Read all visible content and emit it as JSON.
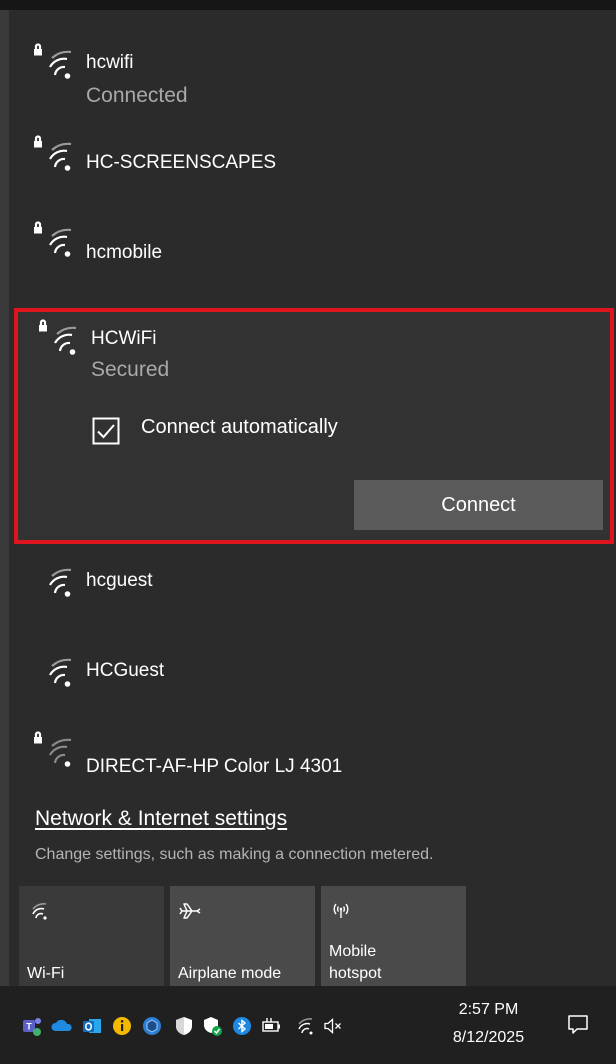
{
  "networks": [
    {
      "name": "hcwifi",
      "status": "Connected",
      "secured": true
    },
    {
      "name": "HC-SCREENSCAPES",
      "secured": true
    },
    {
      "name": "hcmobile",
      "secured": true
    },
    {
      "name": "HCWiFi",
      "status": "Secured",
      "secured": true,
      "connect_automatically_label": "Connect automatically",
      "connect_automatically_checked": true,
      "connect_button_label": "Connect"
    },
    {
      "name": "hcguest",
      "secured": false
    },
    {
      "name": "HCGuest",
      "secured": false
    },
    {
      "name": "DIRECT-AF-HP Color LJ 4301",
      "secured": true
    }
  ],
  "settings": {
    "link_label": "Network & Internet settings",
    "description": "Change settings, such as making a connection metered."
  },
  "quick_actions": [
    {
      "label": "Wi-Fi",
      "icon": "wifi-icon",
      "active": false
    },
    {
      "label": "Airplane mode",
      "icon": "airplane-icon",
      "active": false
    },
    {
      "label_line1": "Mobile",
      "label_line2": "hotspot",
      "icon": "hotspot-icon",
      "active": false
    }
  ],
  "taskbar": {
    "time": "2:57 PM",
    "date": "8/12/2025",
    "icons": [
      "teams-icon",
      "onedrive-icon",
      "outlook-icon",
      "info-icon",
      "app-icon",
      "defender-icon",
      "security-shield-icon",
      "bluetooth-icon",
      "power-battery-icon",
      "wifi-icon",
      "volume-muted-icon"
    ],
    "notification_icon": "action-center-icon"
  },
  "colors": {
    "highlight_border": "#e0141e",
    "panel": "#2b2b2b",
    "button": "#5a5a5a"
  }
}
